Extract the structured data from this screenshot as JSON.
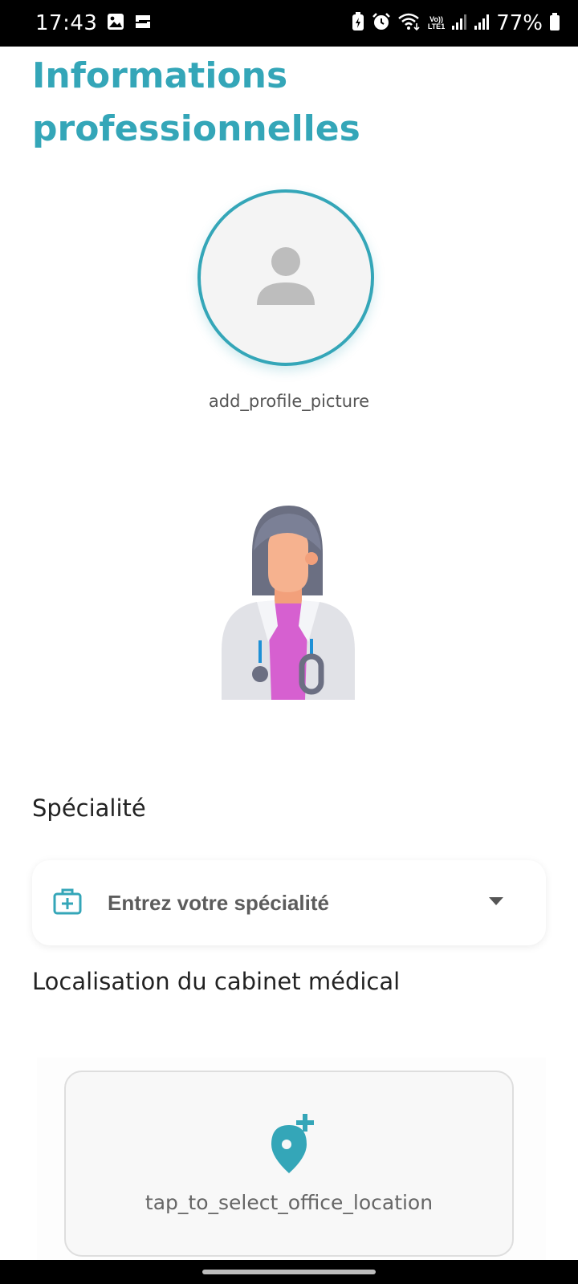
{
  "status_bar": {
    "time": "17:43",
    "volte_top": "Vo))",
    "volte_bottom": "LTE1",
    "battery": "77%"
  },
  "page": {
    "title": "Informations professionnelles"
  },
  "profile": {
    "add_photo_label": "add_profile_picture",
    "icon": "person-icon"
  },
  "specialty": {
    "label": "Spécialité",
    "placeholder": "Entrez votre spécialité",
    "icon": "medical-kit-icon"
  },
  "location": {
    "label": "Localisation du cabinet médical",
    "picker_text": "tap_to_select_office_location",
    "icon": "add-location-icon"
  },
  "colors": {
    "accent": "#34a6b8",
    "status_bar": "#000000",
    "background": "#ffffff"
  }
}
